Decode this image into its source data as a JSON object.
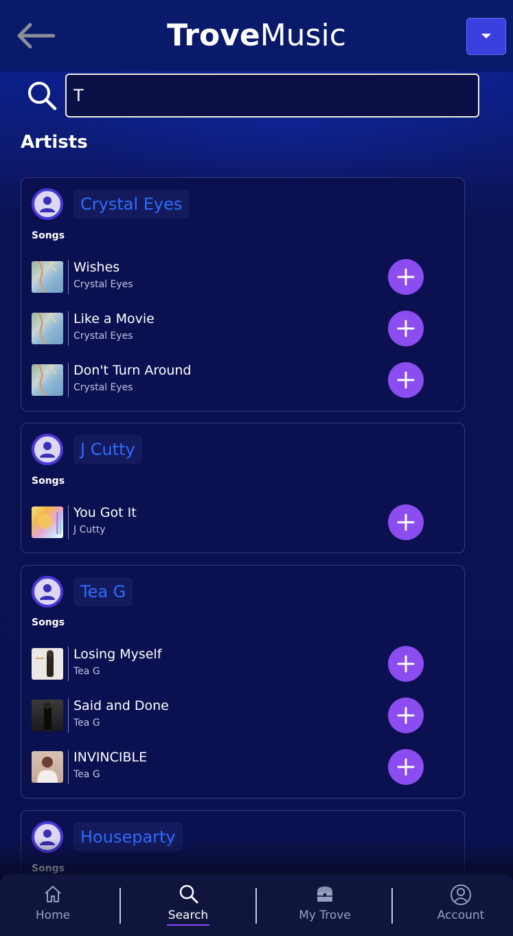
{
  "app": {
    "logo_bold": "Trove",
    "logo_light": "Music"
  },
  "search": {
    "value": "T"
  },
  "section_title": "Artists",
  "songs_label": "Songs",
  "artists": [
    {
      "name": "Crystal Eyes",
      "songs": [
        {
          "title": "Wishes",
          "artist": "Crystal Eyes"
        },
        {
          "title": "Like a Movie",
          "artist": "Crystal Eyes"
        },
        {
          "title": "Don't Turn Around",
          "artist": "Crystal Eyes"
        }
      ]
    },
    {
      "name": "J Cutty",
      "songs": [
        {
          "title": "You Got It",
          "artist": "J Cutty"
        }
      ]
    },
    {
      "name": "Tea G",
      "songs": [
        {
          "title": "Losing Myself",
          "artist": "Tea G"
        },
        {
          "title": "Said and Done",
          "artist": "Tea G"
        },
        {
          "title": "INVINCIBLE",
          "artist": "Tea G"
        }
      ]
    },
    {
      "name": "Houseparty",
      "songs": []
    }
  ],
  "nav": [
    {
      "label": "Home",
      "icon": "home-icon"
    },
    {
      "label": "Search",
      "icon": "search-icon",
      "active": true
    },
    {
      "label": "My Trove",
      "icon": "treasure-chest-icon"
    },
    {
      "label": "Account",
      "icon": "account-icon"
    }
  ],
  "colors": {
    "accent_purple": "#8b4cf0",
    "artist_link_blue": "#2f6bff",
    "menu_button": "#3b3fe0",
    "background": "#0b1252"
  }
}
